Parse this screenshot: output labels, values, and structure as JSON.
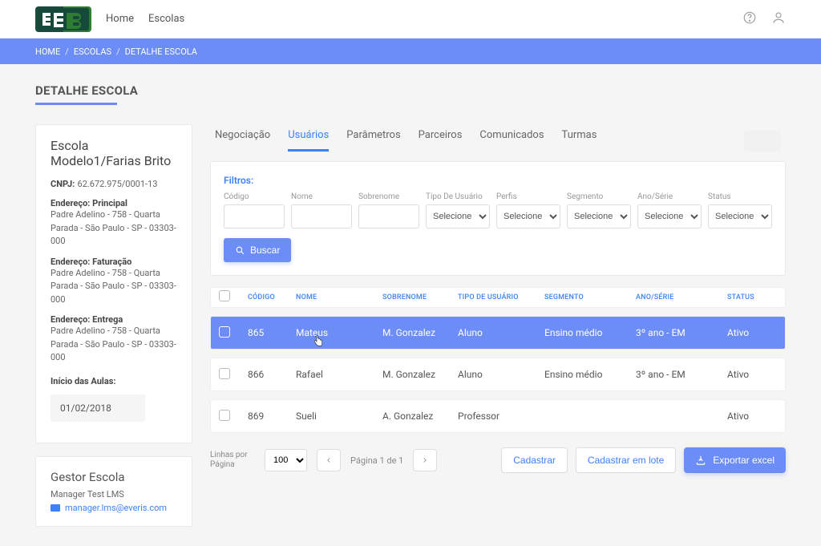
{
  "nav": {
    "home": "Home",
    "escolas": "Escolas"
  },
  "breadcrumb": {
    "home": "HOME",
    "escolas": "ESCOLAS",
    "detail": "DETALHE ESCOLA"
  },
  "page_title": "DETALHE ESCOLA",
  "school": {
    "name": "Escola Modelo1/Farias Brito",
    "cnpj_label": "CNPJ:",
    "cnpj": "62.672.975/0001-13",
    "addr_principal_label": "Endereço: Principal",
    "addr_principal": "Padre Adelino - 758 - Quarta Parada - São Paulo - SP - 03303-000",
    "addr_fat_label": "Endereço: Faturação",
    "addr_fat": "Padre Adelino - 758 - Quarta Parada - São Paulo - SP - 03303-000",
    "addr_ent_label": "Endereço: Entrega",
    "addr_ent": "Padre Adelino - 758 - Quarta Parada - São Paulo - SP - 03303-000",
    "start_label": "Início das Aulas:",
    "start_date": "01/02/2018"
  },
  "manager": {
    "title": "Gestor Escola",
    "name": "Manager Test LMS",
    "email": "manager.lms@everis.com"
  },
  "tabs": {
    "negociacao": "Negociação",
    "usuarios": "Usuários",
    "parametros": "Parâmetros",
    "parceiros": "Parceiros",
    "comunicados": "Comunicados",
    "turmas": "Turmas"
  },
  "filters": {
    "title": "Filtros:",
    "codigo": "Código",
    "nome": "Nome",
    "sobrenome": "Sobrenome",
    "tipo": "Tipo De Usuário",
    "perfis": "Perfis",
    "segmento": "Segmento",
    "anoserie": "Ano/Série",
    "status": "Status",
    "selecione": "Selecione",
    "buscar": "Buscar"
  },
  "table": {
    "headers": {
      "codigo": "CÓDIGO",
      "nome": "NOME",
      "sobrenome": "SOBRENOME",
      "tipo": "TIPO DE USUÁRIO",
      "segmento": "SEGMENTO",
      "anoserie": "ANO/SÉRIE",
      "status": "STATUS"
    },
    "rows": [
      {
        "codigo": "865",
        "nome": "Mateus",
        "sobrenome": "M. Gonzalez",
        "tipo": "Aluno",
        "segmento": "Ensino médio",
        "anoserie": "3º ano - EM",
        "status": "Ativo"
      },
      {
        "codigo": "866",
        "nome": "Rafael",
        "sobrenome": "M. Gonzalez",
        "tipo": "Aluno",
        "segmento": "Ensino médio",
        "anoserie": "3º ano - EM",
        "status": "Ativo"
      },
      {
        "codigo": "869",
        "nome": "Sueli",
        "sobrenome": "A. Gonzalez",
        "tipo": "Professor",
        "segmento": "",
        "anoserie": "",
        "status": "Ativo"
      }
    ]
  },
  "footer": {
    "rows_label": "Linhas por Página",
    "rows_value": "100",
    "page_label": "Página 1 de 1",
    "cadastrar": "Cadastrar",
    "cadastrar_lote": "Cadastrar em lote",
    "exportar": "Exportar excel"
  }
}
